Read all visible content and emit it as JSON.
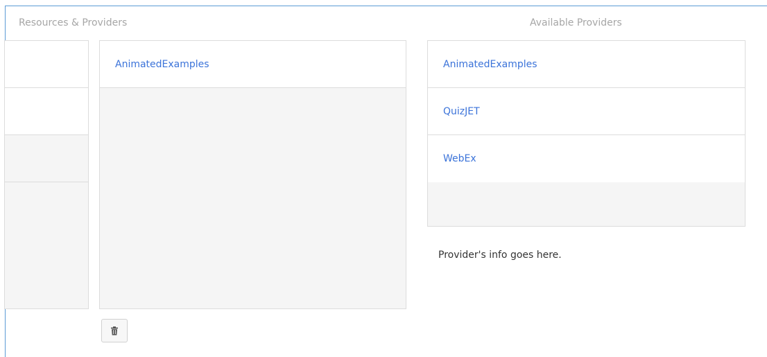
{
  "titles": {
    "resources_providers": "Resources & Providers",
    "available_providers": "Available Providers"
  },
  "selected_providers": [
    {
      "label": "AnimatedExamples"
    }
  ],
  "available_providers": [
    {
      "label": "AnimatedExamples"
    },
    {
      "label": "QuizJET"
    },
    {
      "label": "WebEx"
    }
  ],
  "provider_info": "Provider's info goes here.",
  "icons": {
    "delete": "trash-icon"
  },
  "colors": {
    "link": "#3b73d9",
    "frame_border": "#5b9bd5"
  }
}
